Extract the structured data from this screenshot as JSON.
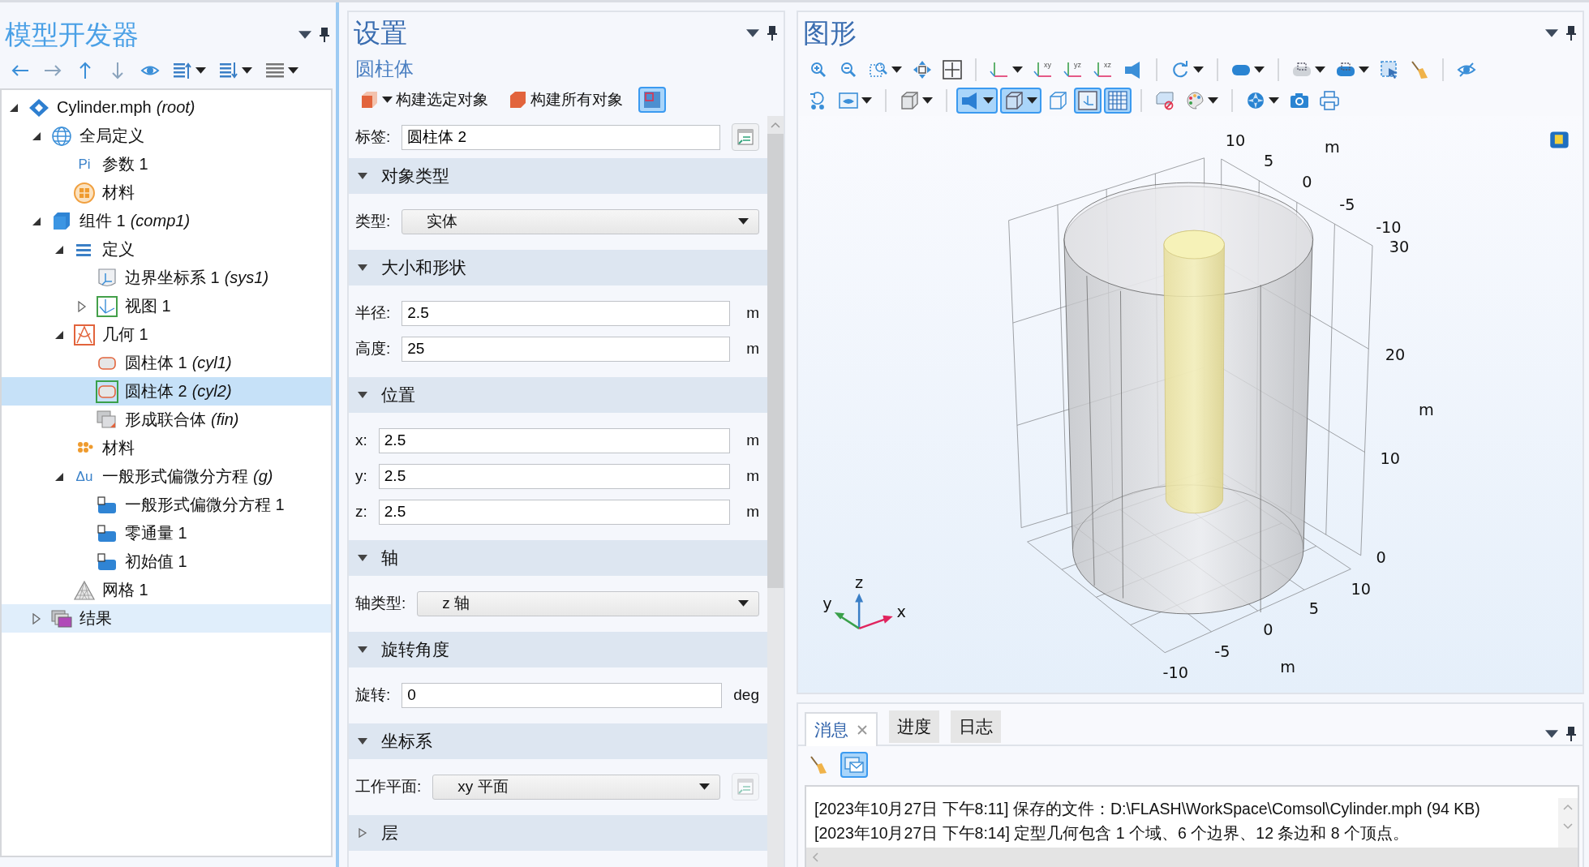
{
  "model_builder": {
    "title": "模型开发器",
    "toolbar": [
      {
        "kind": "back",
        "dropdown": false
      },
      {
        "kind": "forward",
        "dropdown": false
      },
      {
        "kind": "up",
        "dropdown": false
      },
      {
        "kind": "down",
        "dropdown": false
      },
      {
        "kind": "eye",
        "dropdown": false
      },
      {
        "kind": "listup",
        "dropdown": true
      },
      {
        "kind": "listdown",
        "dropdown": true
      },
      {
        "kind": "list",
        "dropdown": true
      }
    ],
    "tree": [
      {
        "label": "Cylinder.mph",
        "tag": "(root)",
        "kind": "model",
        "expanded": true,
        "selected": false,
        "hovered": false,
        "children": [
          {
            "label": "全局定义",
            "kind": "globe",
            "expanded": true,
            "selected": false,
            "hovered": false,
            "children": [
              {
                "label": "参数 1",
                "kind": "parameter",
                "icon_text": "Pi",
                "selected": false,
                "hovered": false
              },
              {
                "label": "材料",
                "kind": "materials",
                "selected": false,
                "hovered": false
              }
            ]
          },
          {
            "label": "组件 1",
            "tag": "(comp1)",
            "kind": "component",
            "expanded": true,
            "selected": false,
            "hovered": false,
            "children": [
              {
                "label": "定义",
                "kind": "definitions",
                "expanded": true,
                "selected": false,
                "hovered": false,
                "children": [
                  {
                    "label": "边界坐标系 1",
                    "tag": "(sys1)",
                    "kind": "coordinate",
                    "selected": false,
                    "hovered": false
                  },
                  {
                    "label": "视图 1",
                    "kind": "view",
                    "expanded": false,
                    "selected": false,
                    "hovered": false
                  }
                ]
              },
              {
                "label": "几何 1",
                "kind": "geometry",
                "expanded": true,
                "selected": false,
                "hovered": false,
                "children": [
                  {
                    "label": "圆柱体 1",
                    "tag": "(cyl1)",
                    "kind": "cylinder",
                    "selected": false,
                    "hovered": false
                  },
                  {
                    "label": "圆柱体 2",
                    "tag": "(cyl2)",
                    "kind": "cylinder",
                    "selected": true,
                    "hovered": false
                  },
                  {
                    "label": "形成联合体",
                    "tag": "(fin)",
                    "kind": "union",
                    "selected": false,
                    "hovered": false
                  }
                ]
              },
              {
                "label": "材料",
                "kind": "material",
                "selected": false,
                "hovered": false
              },
              {
                "label": "一般形式偏微分方程",
                "tag": "(g)",
                "kind": "physics",
                "icon_text": "Δu",
                "expanded": true,
                "selected": false,
                "hovered": false,
                "children": [
                  {
                    "label": "一般形式偏微分方程 1",
                    "kind": "pde",
                    "selected": false,
                    "hovered": false
                  },
                  {
                    "label": "零通量 1",
                    "kind": "pde",
                    "selected": false,
                    "hovered": false
                  },
                  {
                    "label": "初始值 1",
                    "kind": "pde",
                    "selected": false,
                    "hovered": false
                  }
                ]
              },
              {
                "label": "网格 1",
                "kind": "mesh",
                "selected": false,
                "hovered": false
              }
            ]
          },
          {
            "label": "结果",
            "kind": "results",
            "expanded": false,
            "selected": false,
            "hovered": true
          }
        ]
      }
    ]
  },
  "settings": {
    "title": "设置",
    "subtitle": "圆柱体",
    "toolbar": [
      {
        "kind": "build",
        "label": "构建选定对象",
        "dropdown": true,
        "selected": false
      },
      {
        "kind": "buildall",
        "label": "构建所有对象",
        "dropdown": false,
        "selected": false
      },
      {
        "kind": "autobuild",
        "dropdown": false,
        "selected": true
      }
    ],
    "label_row": {
      "kind": "input",
      "label": "标签:",
      "value": "圆柱体 2",
      "action": {
        "disabled": false
      }
    },
    "sections": [
      {
        "title": "对象类型",
        "expanded": true,
        "rows": [
          {
            "kind": "select",
            "label": "类型:",
            "value": "实体"
          }
        ]
      },
      {
        "title": "大小和形状",
        "expanded": true,
        "rows": [
          {
            "kind": "input",
            "label": "半径:",
            "value": "2.5",
            "unit": "m"
          },
          {
            "kind": "input",
            "label": "高度:",
            "value": "25",
            "unit": "m"
          }
        ]
      },
      {
        "title": "位置",
        "expanded": true,
        "rows": [
          {
            "kind": "input",
            "label": "x:",
            "value": "2.5",
            "unit": "m"
          },
          {
            "kind": "input",
            "label": "y:",
            "value": "2.5",
            "unit": "m"
          },
          {
            "kind": "input",
            "label": "z:",
            "value": "2.5",
            "unit": "m"
          }
        ]
      },
      {
        "title": "轴",
        "expanded": true,
        "rows": [
          {
            "kind": "select",
            "label": "轴类型:",
            "value": "z 轴"
          }
        ]
      },
      {
        "title": "旋转角度",
        "expanded": true,
        "rows": [
          {
            "kind": "input",
            "label": "旋转:",
            "value": "0",
            "unit": "deg"
          }
        ]
      },
      {
        "title": "坐标系",
        "expanded": true,
        "rows": [
          {
            "kind": "select",
            "label": "工作平面:",
            "value": "xy 平面",
            "action": {
              "disabled": true
            }
          }
        ]
      },
      {
        "title": "层",
        "expanded": false
      }
    ]
  },
  "graphics": {
    "title": "图形",
    "toolbar_rows": [
      [
        [
          {
            "kind": "zoomin",
            "dropdown": false,
            "selected": false
          },
          {
            "kind": "zoomout",
            "dropdown": false,
            "selected": false
          },
          {
            "kind": "zoombox",
            "dropdown": true,
            "selected": false
          },
          {
            "kind": "pan",
            "dropdown": false,
            "selected": false
          },
          {
            "kind": "extents",
            "dropdown": false,
            "selected": false
          }
        ],
        [
          {
            "kind": "axes",
            "dropdown": true,
            "selected": false
          },
          {
            "kind": "viewplane",
            "text": "xy",
            "dropdown": false,
            "selected": false
          },
          {
            "kind": "viewplane",
            "text": "yz",
            "dropdown": false,
            "selected": false
          },
          {
            "kind": "viewplane",
            "text": "xz",
            "dropdown": false,
            "selected": false
          },
          {
            "kind": "headlight",
            "dropdown": false,
            "selected": false
          }
        ],
        [
          {
            "kind": "rotate",
            "dropdown": true,
            "selected": false
          }
        ],
        [
          {
            "kind": "cylinder",
            "dropdown": true,
            "selected": false
          }
        ],
        [
          {
            "kind": "select1",
            "dropdown": true,
            "selected": false
          },
          {
            "kind": "select2",
            "dropdown": true,
            "selected": false
          },
          {
            "kind": "boxselect",
            "dropdown": false,
            "selected": false
          },
          {
            "kind": "brush",
            "dropdown": false,
            "selected": false
          }
        ],
        [
          {
            "kind": "hide",
            "dropdown": false,
            "selected": false
          }
        ]
      ],
      [
        [
          {
            "kind": "resethide",
            "dropdown": false,
            "selected": false
          },
          {
            "kind": "viewwindow",
            "dropdown": true,
            "selected": false
          }
        ],
        [
          {
            "kind": "transparency",
            "dropdown": true,
            "selected": false
          }
        ],
        [
          {
            "kind": "light",
            "dropdown": true,
            "selected": true
          },
          {
            "kind": "wireframe",
            "dropdown": true,
            "selected": true
          },
          {
            "kind": "box",
            "dropdown": false,
            "selected": false
          },
          {
            "kind": "axisbox",
            "dropdown": false,
            "selected": true
          },
          {
            "kind": "grid",
            "dropdown": false,
            "selected": true
          }
        ],
        [
          {
            "kind": "clear",
            "dropdown": false,
            "selected": false
          },
          {
            "kind": "palette",
            "dropdown": true,
            "selected": false
          }
        ],
        [
          {
            "kind": "aperture",
            "dropdown": true,
            "selected": false
          },
          {
            "kind": "camera",
            "dropdown": false,
            "selected": false
          },
          {
            "kind": "printer",
            "dropdown": false,
            "selected": false
          }
        ]
      ]
    ],
    "viewport": {
      "axis_labels": [
        "10",
        "m",
        "5",
        "0",
        "-5",
        "-10",
        "30",
        "20",
        "m",
        "10",
        "0",
        "10",
        "5",
        "0",
        "-5",
        "-10",
        "m"
      ],
      "triad": [
        "z",
        "y",
        "x"
      ]
    }
  },
  "messages": {
    "tabs": [
      {
        "label": "消息",
        "selected": true,
        "closable": true
      },
      {
        "label": "进度",
        "selected": false,
        "closable": false
      },
      {
        "label": "日志",
        "selected": false,
        "closable": false
      }
    ],
    "toolbar": [
      {
        "kind": "brush",
        "selected": false
      },
      {
        "kind": "mail",
        "selected": true
      }
    ],
    "lines": [
      "[2023年10月27日 下午8:11] 保存的文件：D:\\FLASH\\WorkSpace\\Comsol\\Cylinder.mph (94 KB)",
      "[2023年10月27日 下午8:14] 定型几何包含 1 个域、6 个边界、12 条边和 8 个顶点。"
    ]
  }
}
